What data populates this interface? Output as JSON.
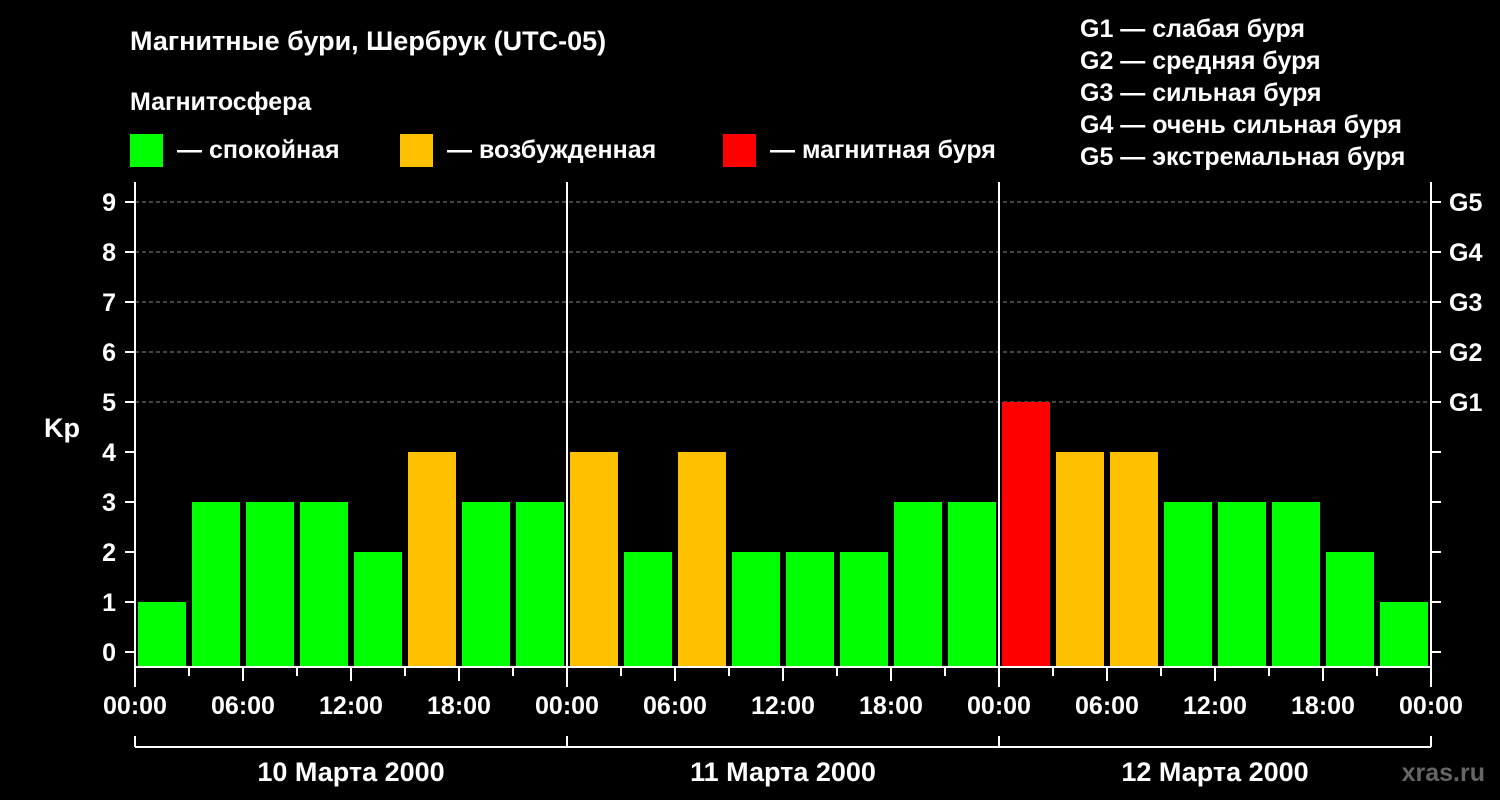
{
  "title": "Магнитные бури, Шербрук (UTC-05)",
  "legend": {
    "heading": "Магнитосфера",
    "items": [
      {
        "key": "quiet",
        "label": "— спокойная",
        "color": "#00ff00"
      },
      {
        "key": "excited",
        "label": "— возбужденная",
        "color": "#ffc000"
      },
      {
        "key": "storm",
        "label": "— магнитная буря",
        "color": "#ff0000"
      }
    ]
  },
  "g_scale_legend": [
    "G1 — слабая буря",
    "G2 — средняя буря",
    "G3 — сильная буря",
    "G4 — очень сильная буря",
    "G5 — экстремальная буря"
  ],
  "watermark": "xras.ru",
  "chart_data": {
    "type": "bar",
    "ylabel": "Kp",
    "ylim": [
      0,
      9
    ],
    "y_ticks": [
      "0",
      "1",
      "2",
      "3",
      "4",
      "5",
      "6",
      "7",
      "8",
      "9"
    ],
    "right_ticks": [
      {
        "value": 5,
        "label": "G1"
      },
      {
        "value": 6,
        "label": "G2"
      },
      {
        "value": 7,
        "label": "G3"
      },
      {
        "value": 8,
        "label": "G4"
      },
      {
        "value": 9,
        "label": "G5"
      }
    ],
    "x_ticks": [
      "00:00",
      "06:00",
      "12:00",
      "18:00",
      "00:00",
      "06:00",
      "12:00",
      "18:00",
      "00:00",
      "06:00",
      "12:00",
      "18:00",
      "00:00"
    ],
    "days": [
      "10 Марта 2000",
      "11 Марта 2000",
      "12 Марта 2000"
    ],
    "grid": true,
    "bar_hour_offsets": [
      3,
      6,
      9,
      12,
      15,
      18,
      21,
      24,
      27,
      30,
      33,
      36,
      39,
      42,
      45,
      48,
      51,
      54,
      57,
      60,
      63,
      66,
      69,
      72
    ],
    "values": [
      1,
      3,
      3,
      3,
      2,
      4,
      3,
      3,
      4,
      2,
      4,
      2,
      2,
      2,
      3,
      3,
      5,
      4,
      4,
      3,
      3,
      3,
      2,
      1
    ],
    "levels": [
      "quiet",
      "quiet",
      "quiet",
      "quiet",
      "quiet",
      "excited",
      "quiet",
      "quiet",
      "excited",
      "quiet",
      "excited",
      "quiet",
      "quiet",
      "quiet",
      "quiet",
      "quiet",
      "storm",
      "excited",
      "excited",
      "quiet",
      "quiet",
      "quiet",
      "quiet",
      "quiet"
    ]
  }
}
